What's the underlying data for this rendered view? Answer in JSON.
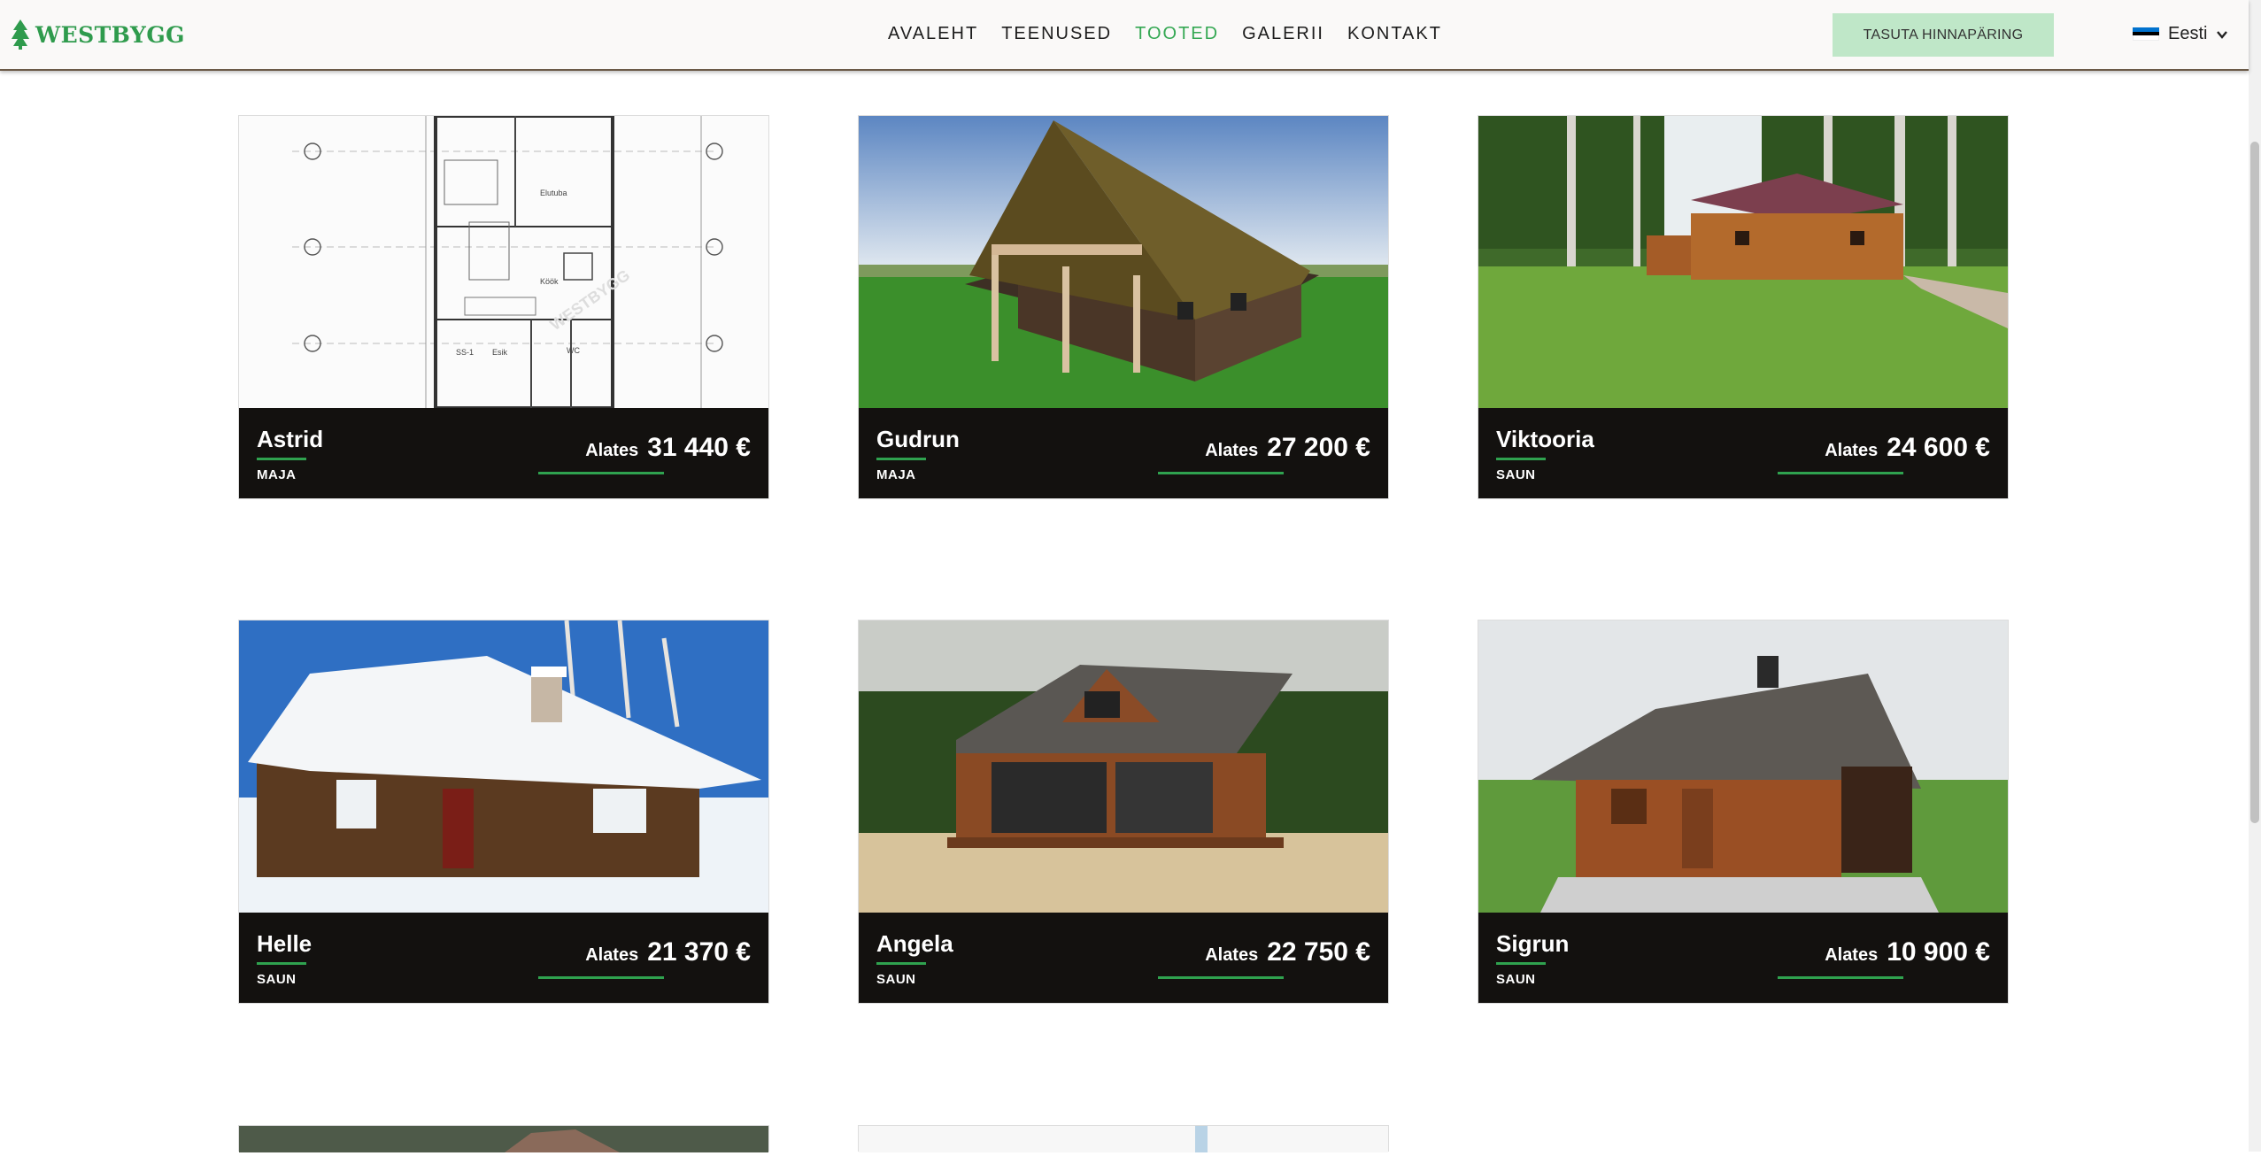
{
  "header": {
    "logo_text": "WESTBYGG",
    "nav": [
      "AVALEHT",
      "TEENUSED",
      "TOOTED",
      "GALERII",
      "KONTAKT"
    ],
    "active_nav": "TOOTED",
    "cta_label": "TASUTA HINNAPÄRING",
    "language": "Eesti",
    "flag_colors": [
      "#0072ce",
      "#000000",
      "#ffffff"
    ]
  },
  "products": [
    {
      "name": "Astrid",
      "type": "MAJA",
      "price_prefix": "Alates",
      "price": "31 440 €"
    },
    {
      "name": "Gudrun",
      "type": "MAJA",
      "price_prefix": "Alates",
      "price": "27 200 €"
    },
    {
      "name": "Viktooria",
      "type": "SAUN",
      "price_prefix": "Alates",
      "price": "24 600 €"
    },
    {
      "name": "Helle",
      "type": "SAUN",
      "price_prefix": "Alates",
      "price": "21 370 €"
    },
    {
      "name": "Angela",
      "type": "SAUN",
      "price_prefix": "Alates",
      "price": "22 750 €"
    },
    {
      "name": "Sigrun",
      "type": "SAUN",
      "price_prefix": "Alates",
      "price": "10 900 €"
    }
  ],
  "colors": {
    "accent": "#34a853",
    "caption_bg": "#13110f",
    "cta_bg": "#bfe7c8"
  }
}
